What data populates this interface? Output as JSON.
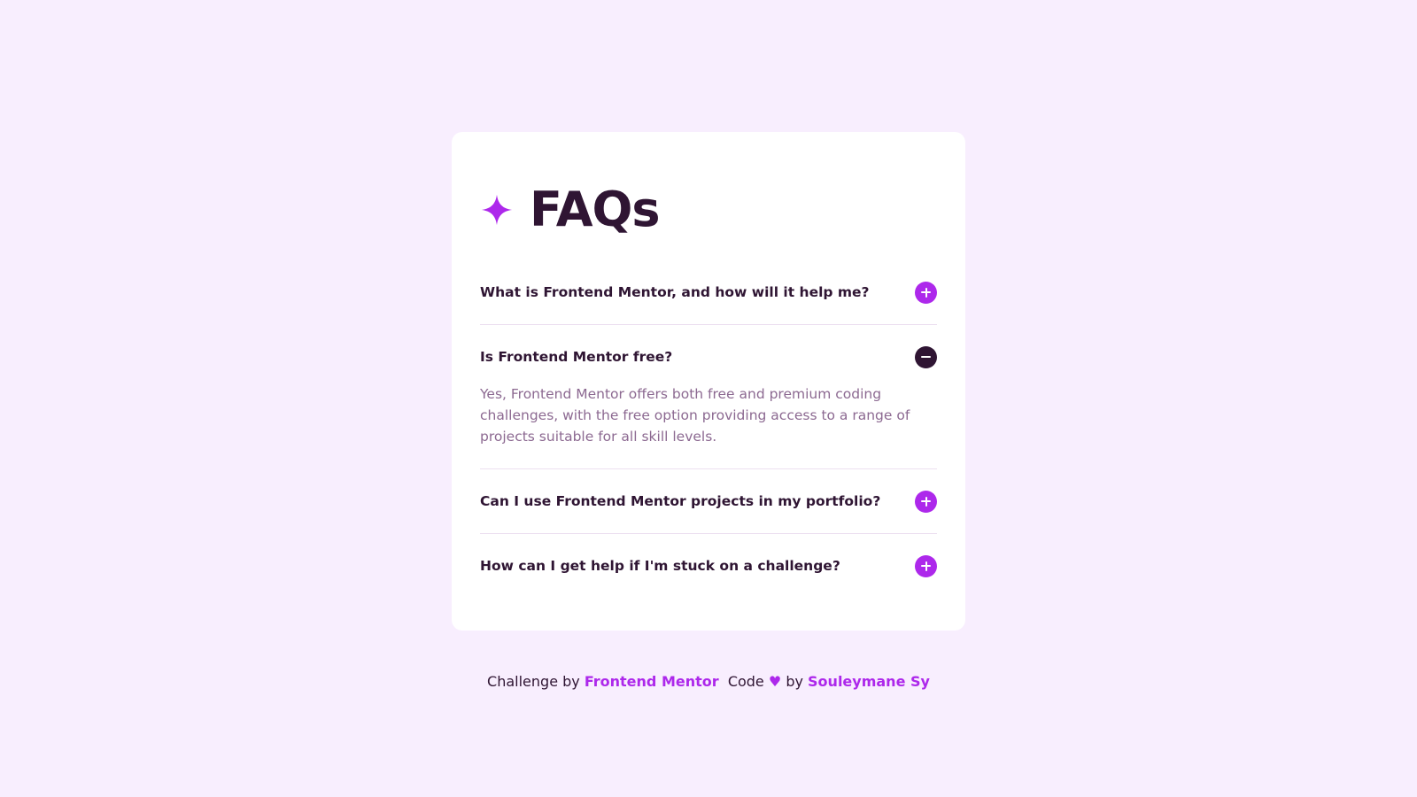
{
  "header": {
    "icon": "star-icon",
    "title": "FAQs",
    "accent_color": "#ad28eb",
    "title_color": "#2f1533"
  },
  "faqs": [
    {
      "question": "What is Frontend Mentor, and how will it help me?",
      "expanded": false,
      "icon": "plus-icon"
    },
    {
      "question": "Is Frontend Mentor free?",
      "expanded": true,
      "icon": "minus-icon",
      "answer": "Yes, Frontend Mentor offers both free and premium coding challenges, with the free option providing access to a range of projects suitable for all skill levels."
    },
    {
      "question": "Can I use Frontend Mentor projects in my portfolio?",
      "expanded": false,
      "icon": "plus-icon"
    },
    {
      "question": "How can I get help if I'm stuck on a challenge?",
      "expanded": false,
      "icon": "plus-icon"
    }
  ],
  "footer": {
    "challenge_prefix": "Challenge by",
    "challenge_link": "Frontend Mentor",
    "code_prefix": "Code",
    "heart": "♥",
    "by": "by",
    "author_link": "Souleymane Sy"
  }
}
